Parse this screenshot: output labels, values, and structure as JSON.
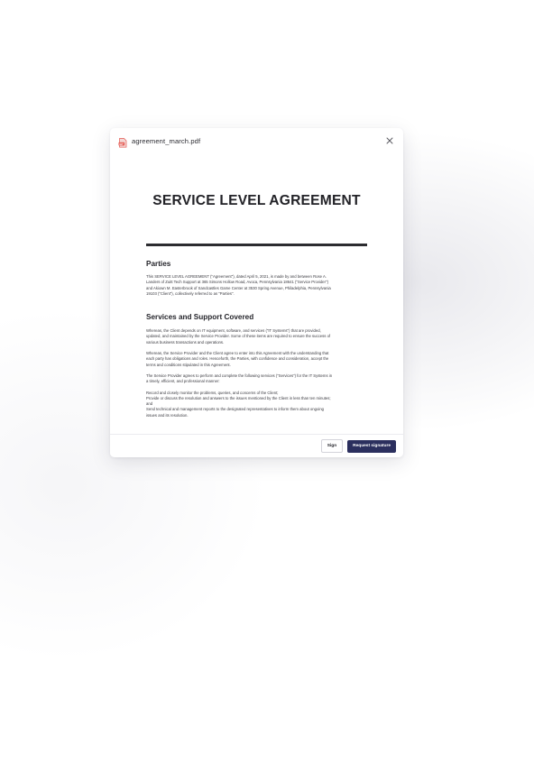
{
  "modal": {
    "file_name": "agreement_march.pdf",
    "file_icon": "pdf-file-icon",
    "close_icon": "close-icon"
  },
  "document": {
    "title": "SERVICE LEVEL AGREEMENT",
    "sections": [
      {
        "heading": "Parties",
        "paragraphs": [
          [
            "This SERVICE LEVEL AGREEMENT (\"Agreement\"), dated April 5, 2021, is made by and between Rose A.",
            "Landers of Zuitt Tech Support at 365 Simons Hollow Road, Avoca, Pennsylvania 18641 (\"Service Provider\")",
            "and Akiown M. Easterbrook of Sandcastles Game Center at 3530 Spring Avenue, Philadelphia, Pennsylvania",
            "19103 (\"Client\"), collectively referred to as \"Parties\"."
          ]
        ]
      },
      {
        "heading": "Services and Support Covered",
        "paragraphs": [
          [
            "Whereas, the Client depends on IT equipment, software, and services (\"IT Systems\") that are provided,",
            "updated, and maintained by the Service Provider. Some of these items are required to ensure the success of",
            "various business transactions and operations."
          ],
          [
            "Whereas, the Service Provider and the Client agree to enter into this Agreement with the understanding that",
            "each party has obligations and roles. Henceforth, the Parties, with confidence and consideration, accept the",
            "terms and conditions stipulated in this Agreement."
          ],
          [
            "The Service Provider agrees to perform and complete the following services (\"Services\") for the IT Systems in",
            "a timely, efficient, and professional manner:"
          ],
          [
            "Record and closely monitor the problems, queries, and concerns of the Client;",
            "Provide or discuss the resolution and answers to the issues mentioned by the Client in less than ten minutes;",
            "and",
            "Send technical and management reports to the designated representatives to inform them about ongoing",
            "issues and its resolution."
          ]
        ]
      }
    ]
  },
  "footer": {
    "sign_label": "Sign",
    "request_label": "Request signature"
  },
  "colors": {
    "primary_button": "#2b2f5e",
    "pdf_icon": "#e4574f"
  }
}
